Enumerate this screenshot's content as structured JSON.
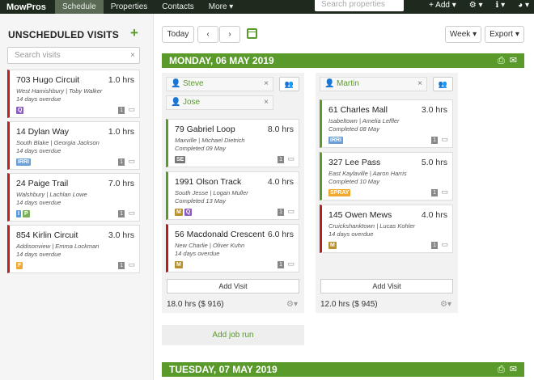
{
  "topbar": {
    "brand": "MowPros",
    "nav": [
      "Schedule",
      "Properties",
      "Contacts",
      "More ▾"
    ],
    "search_placeholder": "Search properties",
    "add_label": "+ Add ▾",
    "settings_label": "⚙ ▾",
    "info_label": "ℹ ▾",
    "avatar_label": "◕ ▾"
  },
  "sidebar": {
    "title": "UNSCHEDULED VISITS",
    "search_placeholder": "Search visits",
    "cards": [
      {
        "name": "703 Hugo Circuit",
        "hours": "1.0 hrs",
        "people": "West Hamishbury | Toby Walker",
        "status": "14 days overdue",
        "tags": [
          {
            "t": "Q",
            "c": "#8a5cc2"
          }
        ],
        "count": "1",
        "overdue": true
      },
      {
        "name": "14 Dylan Way",
        "hours": "1.0 hrs",
        "people": "South Blake | Georgia Jackson",
        "status": "14 days overdue",
        "tags": [
          {
            "t": "IRRI",
            "c": "#6a9fd8"
          }
        ],
        "count": "1",
        "overdue": true
      },
      {
        "name": "24 Paige Trail",
        "hours": "7.0 hrs",
        "people": "Walshbury | Lachlan Lowe",
        "status": "14 days overdue",
        "tags": [
          {
            "t": "I",
            "c": "#5a9be0"
          },
          {
            "t": "P",
            "c": "#7ab05a"
          }
        ],
        "count": "1",
        "overdue": true
      },
      {
        "name": "854 Kirlin Circuit",
        "hours": "3.0 hrs",
        "people": "Addisonview | Emma Lockman",
        "status": "14 days overdue",
        "tags": [
          {
            "t": "F",
            "c": "#f0a830"
          }
        ],
        "count": "1",
        "overdue": true
      }
    ]
  },
  "toolbar": {
    "today": "Today",
    "prev": "‹",
    "next": "›",
    "calendar_icon": "calendar-icon",
    "week": "Week ▾",
    "export": "Export ▾"
  },
  "days": [
    {
      "label": "MONDAY, 06 MAY 2019",
      "runs": [
        {
          "people": [
            "Steve",
            "Jose"
          ],
          "visits": [
            {
              "name": "79 Gabriel Loop",
              "hours": "8.0 hrs",
              "people": "Maxville | Michael Dietrich",
              "status": "Completed 09 May",
              "tags": [
                {
                  "t": "SE",
                  "c": "#777"
                }
              ],
              "count": "1",
              "overdue": false
            },
            {
              "name": "1991 Olson Track",
              "hours": "4.0 hrs",
              "people": "South Jesse | Logan Muller",
              "status": "Completed 13 May",
              "tags": [
                {
                  "t": "M",
                  "c": "#b8902c"
                },
                {
                  "t": "Q",
                  "c": "#8a5cc2"
                }
              ],
              "count": "1",
              "overdue": false
            },
            {
              "name": "56 Macdonald Crescent",
              "hours": "6.0 hrs",
              "people": "New Charlie | Oliver Kuhn",
              "status": "14 days overdue",
              "tags": [
                {
                  "t": "M",
                  "c": "#b8902c"
                }
              ],
              "count": "1",
              "overdue": true
            }
          ],
          "add_visit": "Add Visit",
          "total": "18.0 hrs ($ 916)"
        },
        {
          "people": [
            "Martin"
          ],
          "visits": [
            {
              "name": "61 Charles Mall",
              "hours": "3.0 hrs",
              "people": "Isabeltown | Amelia Leffler",
              "status": "Completed 08 May",
              "tags": [
                {
                  "t": "IRRI",
                  "c": "#6a9fd8"
                }
              ],
              "count": "1",
              "overdue": false
            },
            {
              "name": "327 Lee Pass",
              "hours": "5.0 hrs",
              "people": "East Kaylaville | Aaron Harris",
              "status": "Completed 10 May",
              "tags": [
                {
                  "t": "SPRAY",
                  "c": "#f0a830"
                }
              ],
              "count": "1",
              "overdue": false
            },
            {
              "name": "145 Owen Mews",
              "hours": "4.0 hrs",
              "people": "Cruickshanktown | Lucas Kohler",
              "status": "14 days overdue",
              "tags": [
                {
                  "t": "M",
                  "c": "#b8902c"
                }
              ],
              "count": "1",
              "overdue": true
            }
          ],
          "add_visit": "Add Visit",
          "total": "12.0 hrs ($ 945)"
        }
      ],
      "add_run": "Add job run"
    },
    {
      "label": "TUESDAY, 07 MAY 2019"
    }
  ]
}
